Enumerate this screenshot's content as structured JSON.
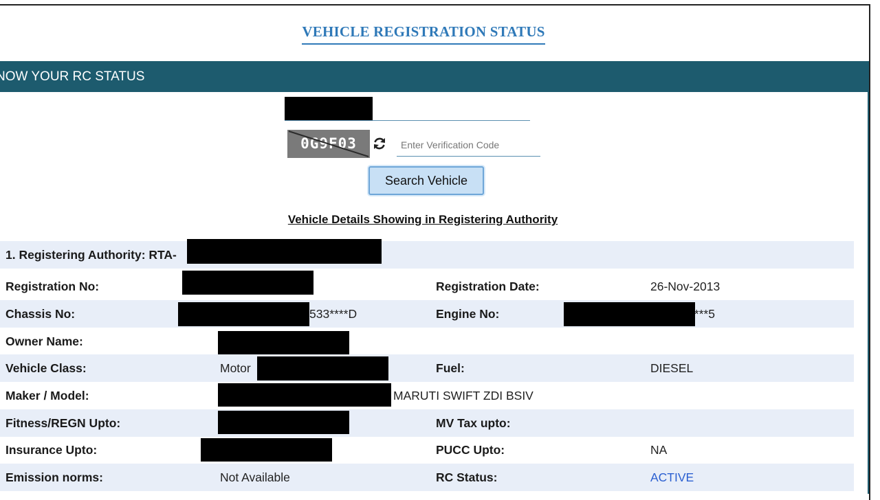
{
  "page_title": "VEHICLE REGISTRATION STATUS",
  "panel_header": "NOW YOUR RC STATUS",
  "captcha": {
    "text": "0G9F03"
  },
  "verification": {
    "placeholder": "Enter Verification Code"
  },
  "search_button": "Search Vehicle",
  "section_title": "Vehicle Details Showing in Registering Authority",
  "registering_authority": "1. Registering Authority: RTA-",
  "details": {
    "registration_no": {
      "label": "Registration No:",
      "value": ""
    },
    "registration_date": {
      "label": "Registration Date:",
      "value": "26-Nov-2013"
    },
    "chassis_no": {
      "label": "Chassis No:",
      "value": "533****D"
    },
    "engine_no": {
      "label": "Engine No:",
      "value": "****5"
    },
    "owner_name": {
      "label": "Owner Name:",
      "value": ""
    },
    "vehicle_class": {
      "label": "Vehicle Class:",
      "value": "Motor"
    },
    "fuel": {
      "label": "Fuel:",
      "value": "DIESEL"
    },
    "maker_model": {
      "label": "Maker / Model:",
      "value": "MARUTI SWIFT ZDI BSIV"
    },
    "fitness_upto": {
      "label": "Fitness/REGN Upto:",
      "value": ""
    },
    "mv_tax_upto": {
      "label": "MV Tax upto:",
      "value": ""
    },
    "insurance_upto": {
      "label": "Insurance Upto:",
      "value": ""
    },
    "pucc_upto": {
      "label": "PUCC Upto:",
      "value": "NA"
    },
    "emission_norms": {
      "label": "Emission norms:",
      "value": "Not Available"
    },
    "rc_status": {
      "label": "RC Status:",
      "value": "ACTIVE"
    }
  },
  "icons": {
    "refresh": "refresh-icon"
  },
  "colors": {
    "header_bg": "#1d5b6e",
    "title": "#2f79b8",
    "row_shade": "#e8eef8",
    "active": "#2a5fd1"
  }
}
